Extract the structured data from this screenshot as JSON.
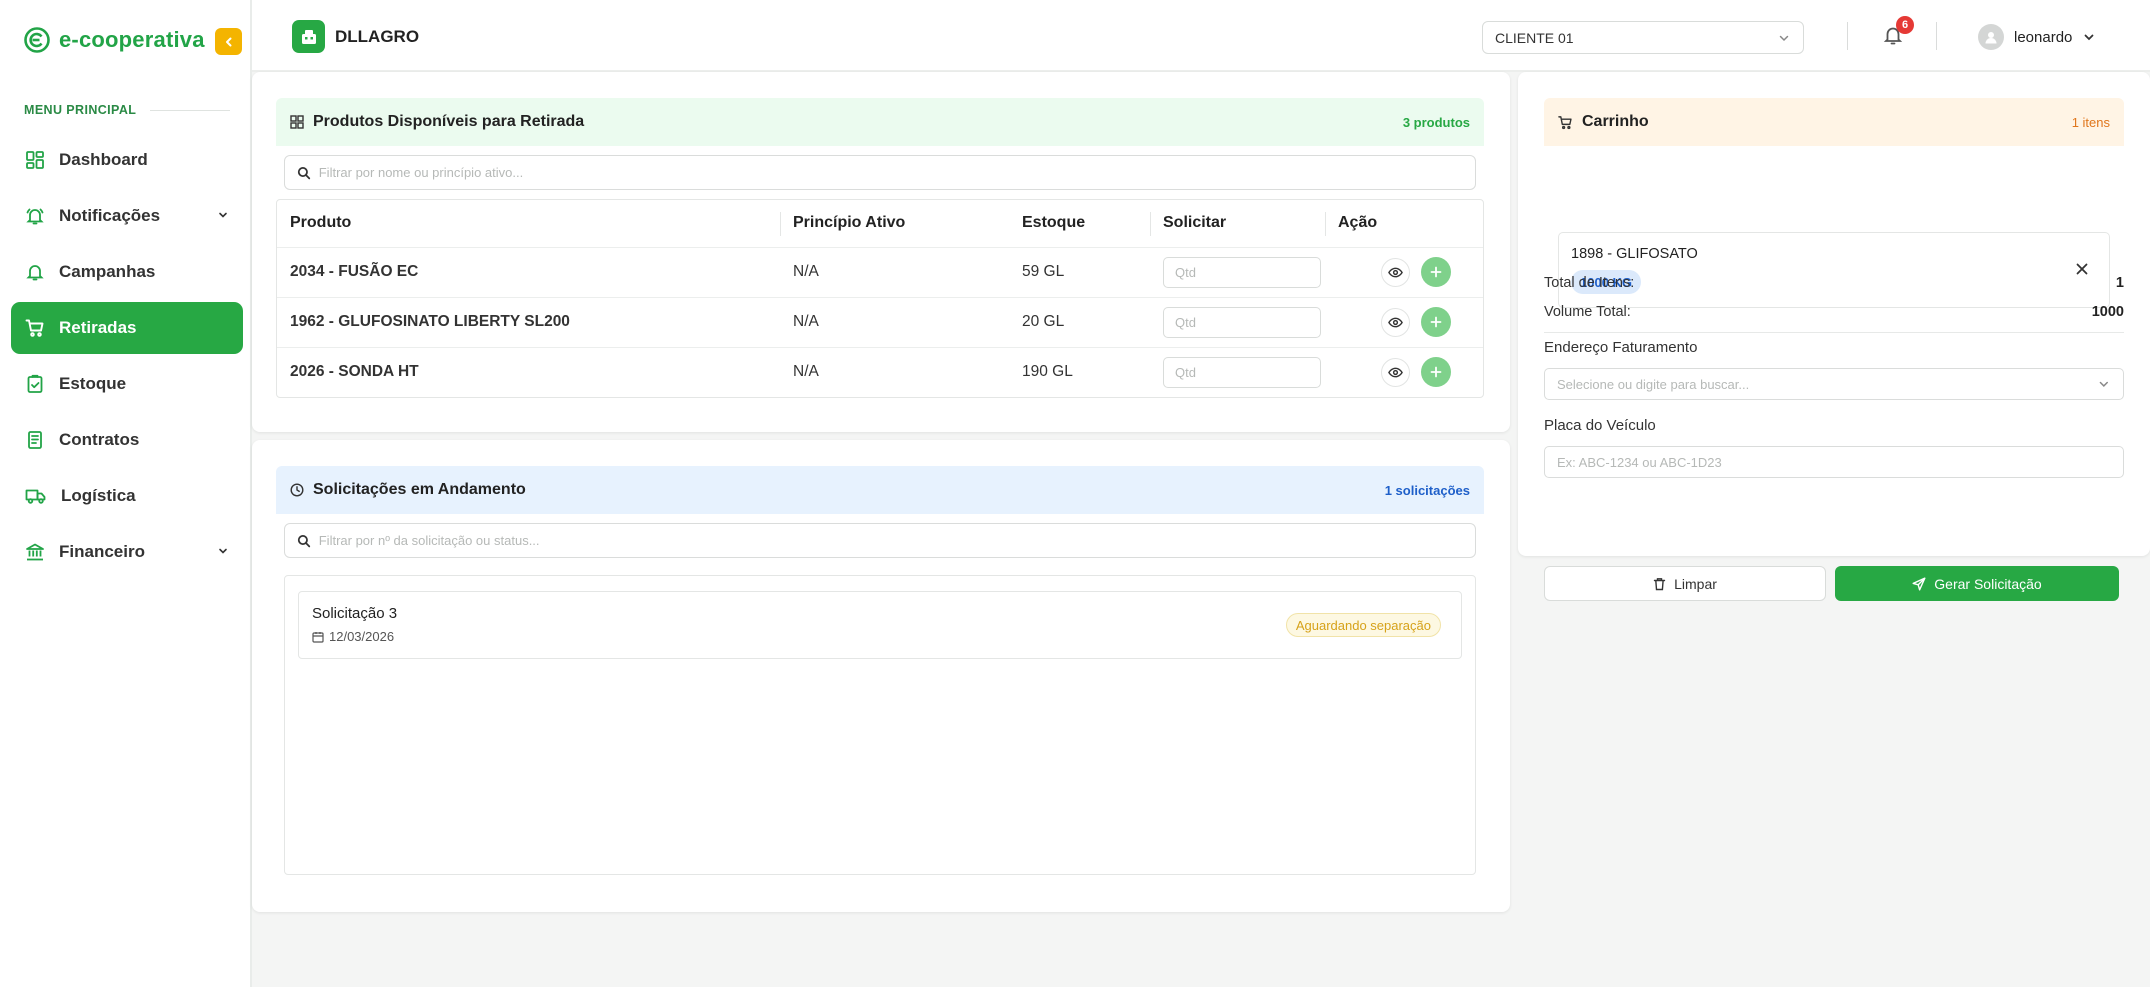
{
  "brand": {
    "logo_text": "e-cooperativa"
  },
  "sidebar": {
    "section_title": "MENU PRINCIPAL",
    "items": [
      {
        "label": "Dashboard"
      },
      {
        "label": "Notificações"
      },
      {
        "label": "Campanhas"
      },
      {
        "label": "Retiradas"
      },
      {
        "label": "Estoque"
      },
      {
        "label": "Contratos"
      },
      {
        "label": "Logística"
      },
      {
        "label": "Financeiro"
      }
    ]
  },
  "header": {
    "company": "DLLAGRO",
    "client_select": "CLIENTE 01",
    "notifications_count": "6",
    "username": "leonardo"
  },
  "products": {
    "title": "Produtos Disponíveis para Retirada",
    "count": "3 produtos",
    "search_placeholder": "Filtrar por nome ou princípio ativo...",
    "columns": [
      "Produto",
      "Princípio Ativo",
      "Estoque",
      "Solicitar",
      "Ação"
    ],
    "qty_placeholder": "Qtd",
    "rows": [
      {
        "name": "2034 - FUSÃO EC",
        "active": "N/A",
        "stock": "59 GL"
      },
      {
        "name": "1962 - GLUFOSINATO LIBERTY SL200",
        "active": "N/A",
        "stock": "20 GL"
      },
      {
        "name": "2026 - SONDA HT",
        "active": "N/A",
        "stock": "190 GL"
      }
    ]
  },
  "requests": {
    "title": "Solicitações em Andamento",
    "count": "1 solicitações",
    "search_placeholder": "Filtrar por nº da solicitação ou status...",
    "items": [
      {
        "title": "Solicitação 3",
        "date": "12/03/2026",
        "status": "Aguardando separação"
      }
    ]
  },
  "cart": {
    "title": "Carrinho",
    "count": "1 itens",
    "items": [
      {
        "name": "1898 - GLIFOSATO",
        "qty": "1000 KG"
      }
    ],
    "total_items_label": "Total de Itens:",
    "total_items_value": "1",
    "volume_label": "Volume Total:",
    "volume_value": "1000",
    "billing_label": "Endereço Faturamento",
    "billing_placeholder": "Selecione ou digite para buscar...",
    "plate_label": "Placa do Veículo",
    "plate_placeholder": "Ex: ABC-1234 ou ABC-1D23",
    "clear_label": "Limpar",
    "generate_label": "Gerar Solicitação"
  },
  "colors": {
    "brand_green": "#27a844",
    "collapse_yellow": "#f4b400",
    "badge_red": "#e53935",
    "pending_yellow": "#d6a21a"
  }
}
